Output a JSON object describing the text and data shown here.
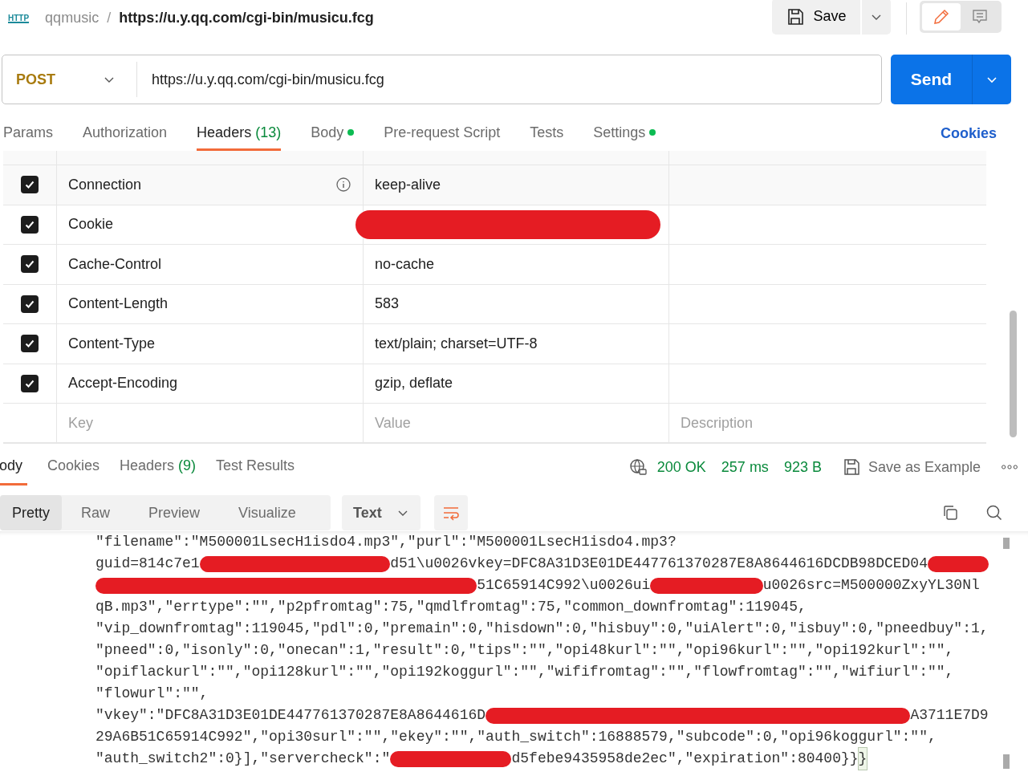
{
  "top_bar": {
    "request_type": "HTTP",
    "collection": "qqmusic",
    "separator": "/",
    "request_name": "https://u.y.qq.com/cgi-bin/musicu.fcg",
    "save_button": "Save",
    "mode_toggle": [
      {
        "kind": "edit",
        "selected": true
      },
      {
        "kind": "comments",
        "selected": false
      }
    ]
  },
  "request": {
    "method": "POST",
    "url": "https://u.y.qq.com/cgi-bin/musicu.fcg",
    "send_button": "Send"
  },
  "request_tabs": [
    {
      "label": "Params",
      "selected": false,
      "indicator": false
    },
    {
      "label": "Authorization",
      "selected": false,
      "indicator": false
    },
    {
      "label": "Headers",
      "count": "(13)",
      "selected": true,
      "indicator": false
    },
    {
      "label": "Body",
      "selected": false,
      "indicator": true
    },
    {
      "label": "Pre-request Script",
      "selected": false,
      "indicator": false
    },
    {
      "label": "Tests",
      "selected": false,
      "indicator": false
    },
    {
      "label": "Settings",
      "selected": false,
      "indicator": true
    }
  ],
  "cookies_link": "Cookies",
  "headers_table": {
    "rows": [
      {
        "checked": true,
        "key": "Connection",
        "info": true,
        "value": "keep-alive",
        "redacted": false
      },
      {
        "checked": true,
        "key": "Cookie",
        "info": false,
        "value": "",
        "redacted": true
      },
      {
        "checked": true,
        "key": "Cache-Control",
        "info": false,
        "value": "no-cache",
        "redacted": false
      },
      {
        "checked": true,
        "key": "Content-Length",
        "info": false,
        "value": "583",
        "redacted": false
      },
      {
        "checked": true,
        "key": "Content-Type",
        "info": false,
        "value": "text/plain; charset=UTF-8",
        "redacted": false
      },
      {
        "checked": true,
        "key": "Accept-Encoding",
        "info": false,
        "value": "gzip, deflate",
        "redacted": false
      }
    ],
    "new_row": {
      "key_placeholder": "Key",
      "value_placeholder": "Value",
      "description_placeholder": "Description"
    }
  },
  "response": {
    "tabs": [
      {
        "label": "ody",
        "selected": true
      },
      {
        "label": "Cookies",
        "selected": false
      },
      {
        "label": "Headers",
        "count": "(9)",
        "selected": false
      },
      {
        "label": "Test Results",
        "selected": false
      }
    ],
    "status": "200 OK",
    "time": "257 ms",
    "size": "923 B",
    "save_example": "Save as Example",
    "view_modes": [
      {
        "label": "Pretty",
        "selected": true
      },
      {
        "label": "Raw",
        "selected": false
      },
      {
        "label": "Preview",
        "selected": false
      },
      {
        "label": "Visualize",
        "selected": false
      }
    ],
    "format": "Text",
    "lines": [
      [
        {
          "kind": "text",
          "text": "\"filename\":\"M500001LsecH1isdo4.mp3\",\"purl\":\"M500001LsecH1isdo4.mp3?"
        }
      ],
      [
        {
          "kind": "text",
          "text": "guid=814c7e1"
        },
        {
          "kind": "redaction"
        },
        {
          "kind": "text",
          "text": "d51\\u0026vkey=DFC8A31D3E01DE447761370287E8A8644616DCDB98DCED04"
        },
        {
          "kind": "redaction"
        }
      ],
      [
        {
          "kind": "redaction"
        },
        {
          "kind": "text",
          "text": "51C65914C992\\u0026ui"
        },
        {
          "kind": "redaction"
        },
        {
          "kind": "text",
          "text": "u0026src=M500000ZxyYL30Nl"
        }
      ],
      [
        {
          "kind": "text",
          "text": "qB.mp3\",\"errtype\":\"\",\"p2pfromtag\":75,\"qmdlfromtag\":75,\"common_downfromtag\":119045,"
        }
      ],
      [
        {
          "kind": "text",
          "text": "\"vip_downfromtag\":119045,\"pdl\":0,\"premain\":0,\"hisdown\":0,\"hisbuy\":0,\"uiAlert\":0,\"isbuy\":0,\"pneedbuy\":1,"
        }
      ],
      [
        {
          "kind": "text",
          "text": "\"pneed\":0,\"isonly\":0,\"onecan\":1,\"result\":0,\"tips\":\"\",\"opi48kurl\":\"\",\"opi96kurl\":\"\",\"opi192kurl\":\"\","
        }
      ],
      [
        {
          "kind": "text",
          "text": "\"opiflackurl\":\"\",\"opi128kurl\":\"\",\"opi192koggurl\":\"\",\"wififromtag\":\"\",\"flowfromtag\":\"\",\"wifiurl\":\"\","
        }
      ],
      [
        {
          "kind": "text",
          "text": "\"flowurl\":\"\","
        }
      ],
      [
        {
          "kind": "text",
          "text": "\"vkey\":\"DFC8A31D3E01DE447761370287E8A8644616D"
        },
        {
          "kind": "redaction"
        },
        {
          "kind": "text",
          "text": "A3711E7D9"
        }
      ],
      [
        {
          "kind": "text",
          "text": "29A6B51C65914C992\",\"opi30surl\":\"\",\"ekey\":\"\",\"auth_switch\":16888579,\"subcode\":0,\"opi96koggurl\":\"\","
        }
      ],
      [
        {
          "kind": "text",
          "text": "\"auth_switch2\":0}],\"servercheck\":\""
        },
        {
          "kind": "redaction"
        },
        {
          "kind": "text",
          "text": "d5febe9435958de2ec\",\"expiration\":80400}}"
        },
        {
          "kind": "match",
          "text": "}"
        }
      ]
    ]
  }
}
